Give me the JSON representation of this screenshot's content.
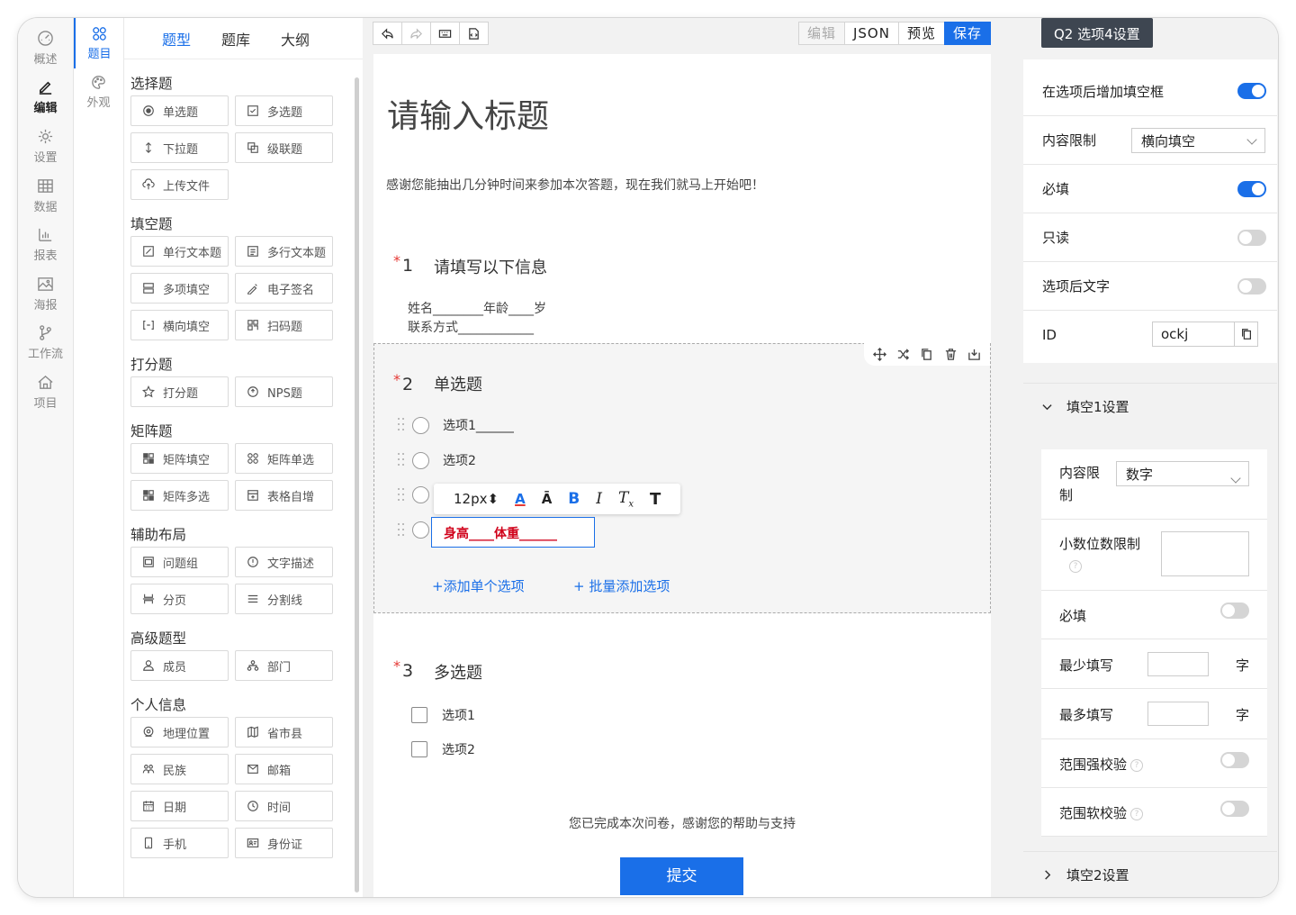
{
  "rail": [
    {
      "label": "概述",
      "icon": "gauge-icon"
    },
    {
      "label": "编辑",
      "icon": "pencil-icon",
      "active": true
    },
    {
      "label": "设置",
      "icon": "gear-icon"
    },
    {
      "label": "数据",
      "icon": "table-icon"
    },
    {
      "label": "报表",
      "icon": "bar-chart-icon"
    },
    {
      "label": "海报",
      "icon": "image-icon"
    },
    {
      "label": "工作流",
      "icon": "workflow-icon"
    },
    {
      "label": "项目",
      "icon": "home-icon"
    }
  ],
  "subrail": [
    {
      "label": "题目",
      "icon": "grid-circles-icon",
      "active": true
    },
    {
      "label": "外观",
      "icon": "palette-icon"
    }
  ],
  "palette": {
    "tabs": [
      "题型",
      "题库",
      "大纲"
    ],
    "active_tab": "题型",
    "categories": [
      {
        "name": "选择题",
        "items": [
          {
            "label": "单选题",
            "icon": "radio-icon"
          },
          {
            "label": "多选题",
            "icon": "checkbox-icon"
          },
          {
            "label": "下拉题",
            "icon": "sort-icon"
          },
          {
            "label": "级联题",
            "icon": "cascade-icon"
          },
          {
            "label": "上传文件",
            "icon": "upload-icon"
          }
        ]
      },
      {
        "name": "填空题",
        "items": [
          {
            "label": "单行文本题",
            "icon": "edit-icon"
          },
          {
            "label": "多行文本题",
            "icon": "multiline-icon"
          },
          {
            "label": "多项填空",
            "icon": "multi-fill-icon"
          },
          {
            "label": "电子签名",
            "icon": "signature-icon"
          },
          {
            "label": "横向填空",
            "icon": "bracket-icon"
          },
          {
            "label": "扫码题",
            "icon": "qrcode-icon"
          }
        ]
      },
      {
        "name": "打分题",
        "items": [
          {
            "label": "打分题",
            "icon": "star-icon"
          },
          {
            "label": "NPS题",
            "icon": "nps-icon"
          }
        ]
      },
      {
        "name": "矩阵题",
        "items": [
          {
            "label": "矩阵填空",
            "icon": "matrix-fill-icon"
          },
          {
            "label": "矩阵单选",
            "icon": "matrix-radio-icon"
          },
          {
            "label": "矩阵多选",
            "icon": "matrix-check-icon"
          },
          {
            "label": "表格自增",
            "icon": "table-add-icon"
          }
        ]
      },
      {
        "name": "辅助布局",
        "items": [
          {
            "label": "问题组",
            "icon": "group-icon"
          },
          {
            "label": "文字描述",
            "icon": "info-icon"
          },
          {
            "label": "分页",
            "icon": "page-break-icon"
          },
          {
            "label": "分割线",
            "icon": "divider-icon"
          }
        ]
      },
      {
        "name": "高级题型",
        "items": [
          {
            "label": "成员",
            "icon": "user-icon"
          },
          {
            "label": "部门",
            "icon": "org-icon"
          }
        ]
      },
      {
        "name": "个人信息",
        "items": [
          {
            "label": "地理位置",
            "icon": "location-icon"
          },
          {
            "label": "省市县",
            "icon": "map-icon"
          },
          {
            "label": "民族",
            "icon": "people-icon"
          },
          {
            "label": "邮箱",
            "icon": "mail-icon"
          },
          {
            "label": "日期",
            "icon": "calendar-icon"
          },
          {
            "label": "时间",
            "icon": "clock-icon"
          },
          {
            "label": "手机",
            "icon": "phone-icon"
          },
          {
            "label": "身份证",
            "icon": "id-card-icon"
          }
        ]
      }
    ]
  },
  "toolbar": {
    "icons": [
      "undo-icon",
      "redo-icon",
      "keyboard-icon",
      "code-icon"
    ],
    "edit_label": "编辑",
    "json_label": "JSON",
    "preview_label": "预览",
    "save_label": "保存"
  },
  "survey": {
    "title": "请输入标题",
    "description": "感谢您能抽出几分钟时间来参加本次答题，现在我们就马上开始吧！",
    "q1": {
      "num": "1",
      "title": "请填写以下信息",
      "line1": "姓名________年龄____岁",
      "line2": "联系方式____________"
    },
    "q2": {
      "num": "2",
      "title": "单选题",
      "options": [
        "选项1______",
        "选项2",
        "",
        ""
      ],
      "editing_text": "身高____体重______",
      "format_size": "12px",
      "add_single": "+添加单个选项",
      "add_batch": "+ 批量添加选项"
    },
    "q3": {
      "num": "3",
      "title": "多选题",
      "options": [
        "选项1",
        "选项2"
      ]
    },
    "end_text": "您已完成本次问卷，感谢您的帮助与支持",
    "submit_label": "提交"
  },
  "settings": {
    "header": "Q2 选项4设置",
    "add_blank_label": "在选项后增加填空框",
    "add_blank_on": true,
    "content_limit_label": "内容限制",
    "content_limit_value": "横向填空",
    "required_label": "必填",
    "required_on": true,
    "readonly_label": "只读",
    "readonly_on": false,
    "after_text_label": "选项后文字",
    "after_text_on": false,
    "id_label": "ID",
    "id_value": "ockj",
    "blank1": {
      "title": "填空1设置",
      "content_limit_label": "内容限制",
      "content_limit_value": "数字",
      "decimal_label": "小数位数限制",
      "decimal_value": "",
      "required_label": "必填",
      "required_on": false,
      "min_label": "最少填写",
      "min_value": "",
      "max_label": "最多填写",
      "max_value": "",
      "unit": "字",
      "strong_label": "范围强校验",
      "strong_on": false,
      "soft_label": "范围软校验",
      "soft_on": false
    },
    "blank2_title": "填空2设置"
  },
  "colors": {
    "accent": "#1a6fe8",
    "required": "#e53935",
    "edit_text": "#d0021b",
    "header_bg": "#3e4651"
  }
}
